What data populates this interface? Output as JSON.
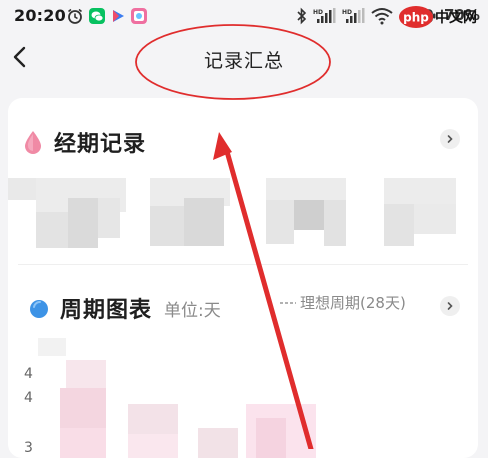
{
  "status_bar": {
    "time": "20:20",
    "battery": "70%",
    "watermark": "php 中文网"
  },
  "nav": {
    "title": "记录汇总"
  },
  "sections": {
    "period_record": {
      "title": "经期记录"
    },
    "cycle_chart": {
      "title": "周期图表",
      "unit": "单位:天",
      "ideal_cycle": "理想周期(28天)",
      "axis_labels": [
        "4",
        "4",
        "3"
      ]
    }
  },
  "colors": {
    "accent_red": "#e02d2d",
    "drop_pink": "#f08aa5",
    "drop_blue": "#3d93e6",
    "card_bg": "#ffffff",
    "page_bg": "#f4f4f6"
  },
  "icons": {
    "alarm": "alarm-icon",
    "wechat": "wechat-icon",
    "play": "play-icon",
    "gallery": "gallery-icon",
    "bluetooth": "bluetooth-icon",
    "signal": "signal-icon",
    "wifi": "wifi-icon",
    "battery": "battery-icon",
    "back": "back-arrow-icon",
    "chevron": "chevron-right-icon",
    "drop_pink": "pink-drop-icon",
    "drop_blue": "blue-drop-icon"
  }
}
